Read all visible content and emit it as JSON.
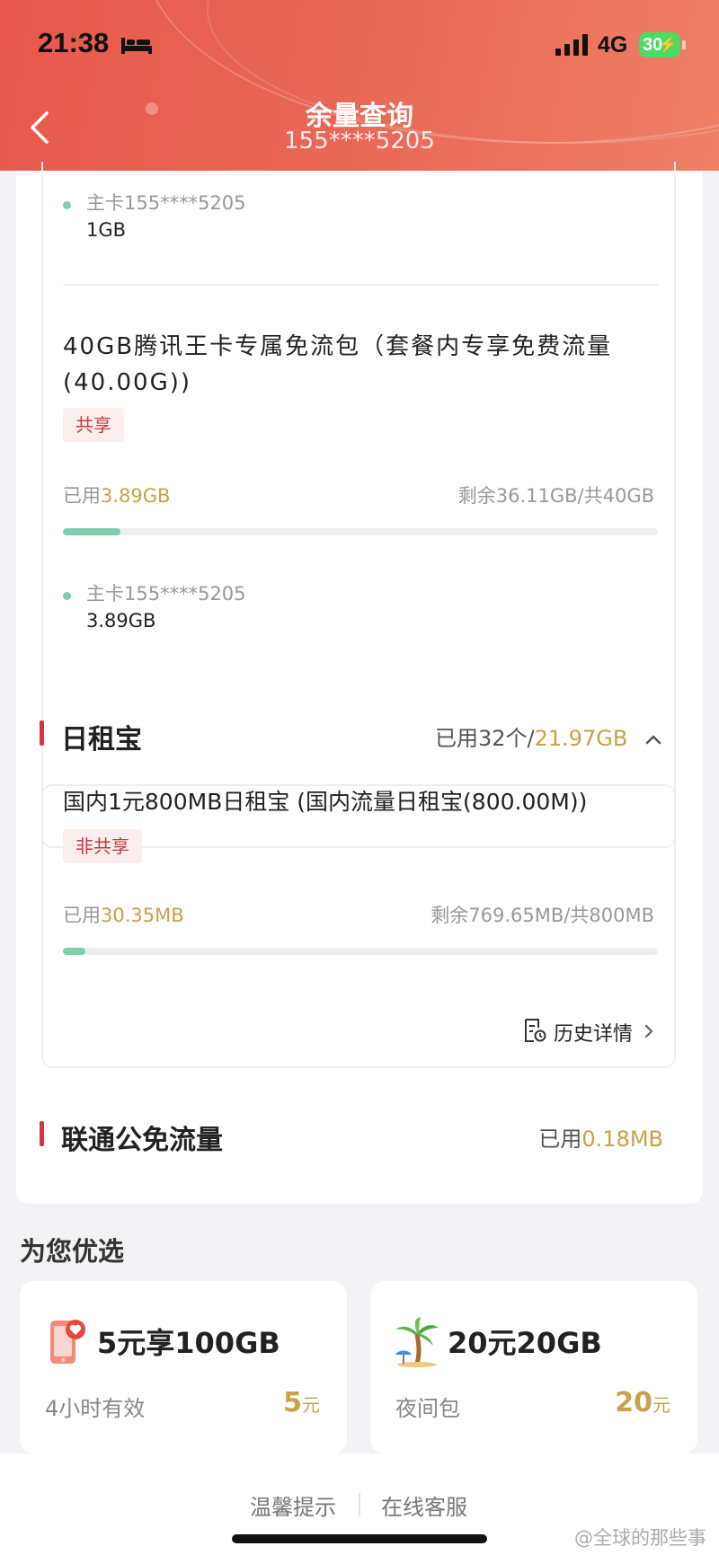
{
  "status_bar": {
    "time": "21:38",
    "network": "4G",
    "battery": "30"
  },
  "header": {
    "title": "余量查询",
    "subtitle": "155****5205"
  },
  "card_a": {
    "member_top": {
      "label": "主卡155****5205",
      "value": "1GB"
    },
    "package": {
      "title": "40GB腾讯王卡专属免流包（套餐内专享免费流量(40.00G))",
      "tag": "共享",
      "used_prefix": "已用",
      "used_value": "3.89GB",
      "remaining": "剩余36.11GB/共40GB",
      "progress": 0.0973,
      "member": {
        "label": "主卡155****5205",
        "value": "3.89GB"
      }
    }
  },
  "section_rizubao": {
    "title": "日租宝",
    "used_prefix": "已用32个/",
    "used_value": "21.97GB",
    "package": {
      "title": "国内1元800MB日租宝 (国内流量日租宝(800.00M))",
      "tag": "非共享",
      "used_prefix": "已用",
      "used_value": "30.35MB",
      "remaining": "剩余769.65MB/共800MB",
      "progress": 0.0379,
      "history_label": "历史详情"
    }
  },
  "section_free": {
    "title": "联通公免流量",
    "used_prefix": "已用",
    "used_value": "0.18MB"
  },
  "recommend": {
    "title": "为您优选",
    "cards": [
      {
        "name": "5元享100GB",
        "desc": "4小时有效",
        "price": "5",
        "unit": "元",
        "icon": "phone-heart-icon"
      },
      {
        "name": "20元20GB",
        "desc": "夜间包",
        "price": "20",
        "unit": "元",
        "icon": "palm-tree-icon"
      }
    ]
  },
  "bottom": {
    "tips": "温馨提示",
    "service": "在线客服",
    "watermark": "@全球的那些事"
  },
  "colors": {
    "header": "#e8584c",
    "accent_gold": "#c8a24a",
    "progress": "#7fcfae",
    "tag_red": "#c23b3f"
  }
}
